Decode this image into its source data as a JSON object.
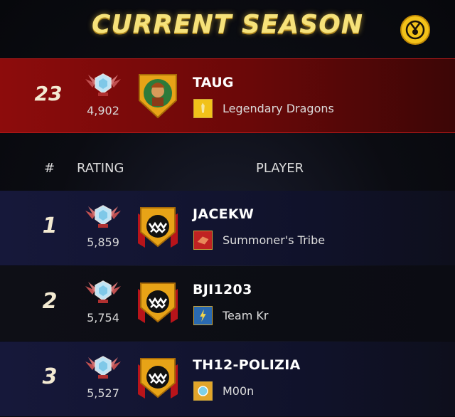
{
  "header": {
    "title": "CURRENT SEASON",
    "medal_icon": "medal-icon"
  },
  "columns": {
    "rank": "#",
    "rating": "RATING",
    "player": "PLAYER"
  },
  "my_entry": {
    "rank": "23",
    "rating": "4,902",
    "player": "TAUG",
    "guild": "Legendary Dragons",
    "avatar_icon": "warrior-avatar-icon",
    "guild_icon": "guild-banner-icon"
  },
  "rows": [
    {
      "rank": "1",
      "rating": "5,859",
      "player": "JACEKW",
      "guild": "Summoner's Tribe",
      "avatar_icon": "monster-avatar-icon",
      "guild_icon": "guild-banner-icon"
    },
    {
      "rank": "2",
      "rating": "5,754",
      "player": "BJI1203",
      "guild": "Team Kr",
      "avatar_icon": "monster-avatar-icon",
      "guild_icon": "guild-banner-icon"
    },
    {
      "rank": "3",
      "rating": "5,527",
      "player": "TH12-POLIZIA",
      "guild": "M00n",
      "avatar_icon": "monster-avatar-icon",
      "guild_icon": "guild-banner-icon"
    }
  ],
  "colors": {
    "title": "#f6e27a",
    "highlight_row": "#8d0c0c",
    "row_bg": "#16183a",
    "gold": "#f2c21a"
  }
}
